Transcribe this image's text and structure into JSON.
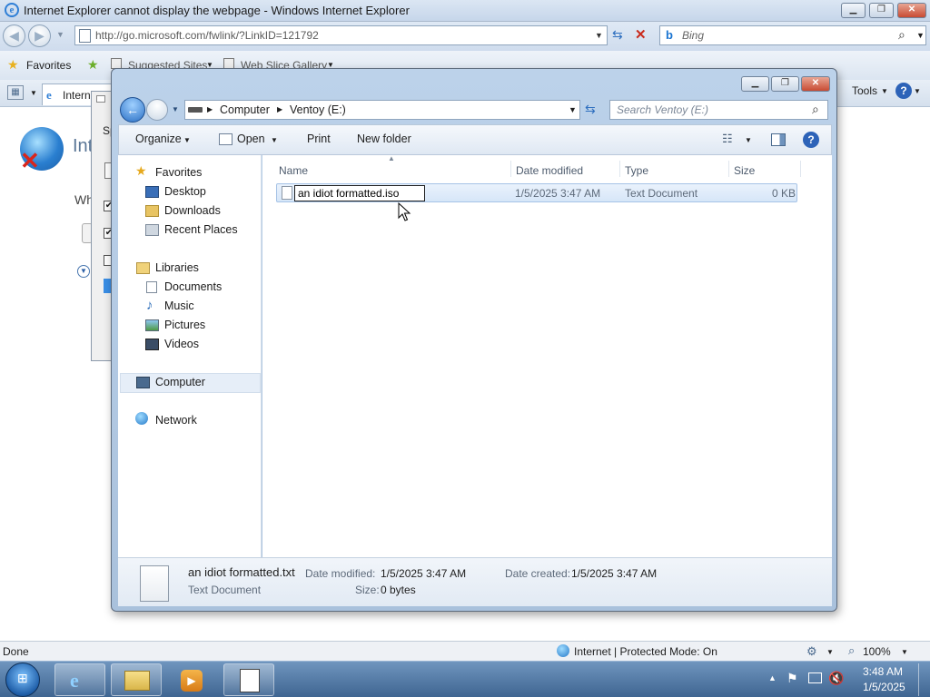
{
  "ie": {
    "title": "Internet Explorer cannot display the webpage - Windows Internet Explorer",
    "address": "http://go.microsoft.com/fwlink/?LinkID=121792",
    "search_placeholder": "Bing",
    "favorites_label": "Favorites",
    "suggested_sites": "Suggested Sites",
    "web_slice_gallery": "Web Slice Gallery",
    "tab_label": "Intern",
    "tools_label": "Tools",
    "page_heading_partial": "Int",
    "body_partial": "Wh",
    "status_done": "Done",
    "status_zone": "Internet | Protected Mode: On",
    "zoom": "100%",
    "dialog_partial": "Sp"
  },
  "explorer": {
    "breadcrumb": [
      "Computer",
      "Ventoy (E:)"
    ],
    "search_placeholder": "Search Ventoy (E:)",
    "toolbar": {
      "organize": "Organize",
      "open": "Open",
      "print": "Print",
      "new_folder": "New folder"
    },
    "nav": {
      "favorites": "Favorites",
      "desktop": "Desktop",
      "downloads": "Downloads",
      "recent_places": "Recent Places",
      "libraries": "Libraries",
      "documents": "Documents",
      "music": "Music",
      "pictures": "Pictures",
      "videos": "Videos",
      "computer": "Computer",
      "network": "Network"
    },
    "columns": {
      "name": "Name",
      "date_modified": "Date modified",
      "type": "Type",
      "size": "Size"
    },
    "file": {
      "rename_value": "an idiot formatted.iso",
      "date_modified": "1/5/2025 3:47 AM",
      "type": "Text Document",
      "size": "0 KB"
    },
    "details": {
      "name": "an idiot formatted.txt",
      "type": "Text Document",
      "date_modified_label": "Date modified:",
      "date_modified": "1/5/2025 3:47 AM",
      "date_created_label": "Date created:",
      "date_created": "1/5/2025 3:47 AM",
      "size_label": "Size:",
      "size": "0 bytes"
    }
  },
  "taskbar": {
    "time": "3:48 AM",
    "date": "1/5/2025"
  },
  "colors": {
    "accent": "#3a8ee6",
    "selection": "#dbe9f8",
    "taskbar": "#4a6f99"
  }
}
